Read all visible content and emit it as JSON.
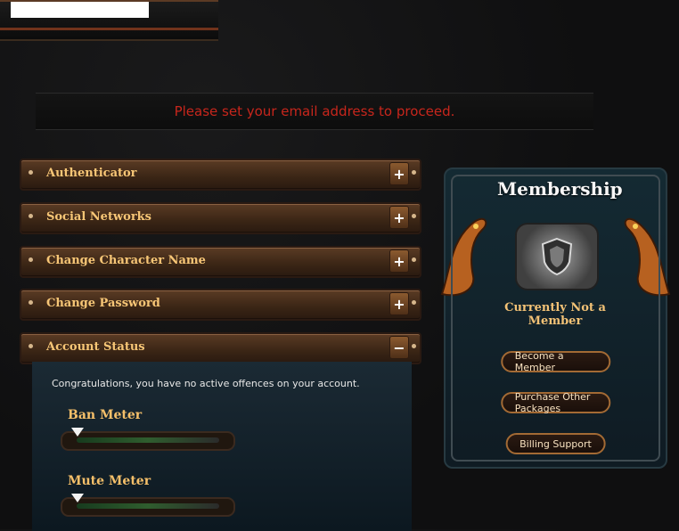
{
  "notice": {
    "text": "Please set your email address to proceed."
  },
  "panels": [
    {
      "label": "Authenticator",
      "toggle": "+"
    },
    {
      "label": "Social Networks",
      "toggle": "+"
    },
    {
      "label": "Change Character Name",
      "toggle": "+"
    },
    {
      "label": "Change Password",
      "toggle": "+"
    },
    {
      "label": "Account Status",
      "toggle": "−"
    }
  ],
  "account_status": {
    "message": "Congratulations, you have no active offences on your account.",
    "ban_meter": {
      "label": "Ban Meter",
      "level": 0
    },
    "mute_meter": {
      "label": "Mute Meter",
      "level": 0
    }
  },
  "membership": {
    "title": "Membership",
    "status": "Currently Not a Member",
    "buttons": [
      "Become a Member",
      "Purchase Other Packages",
      "Billing Support"
    ]
  },
  "colors": {
    "notice": "#c7261c",
    "gold": "#f2c77a",
    "panel_bg": "#3a2515"
  }
}
